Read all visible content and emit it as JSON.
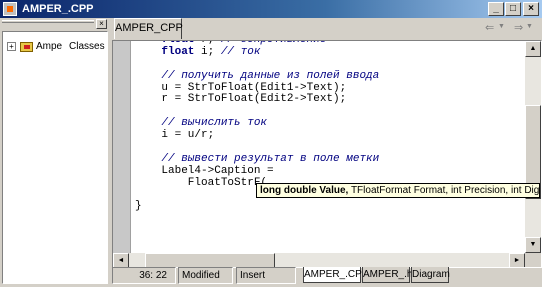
{
  "window": {
    "title": "AMPER_.CPP",
    "buttons": {
      "minimize": "_",
      "maximize": "□",
      "close": "×"
    }
  },
  "left_panel": {
    "close_glyph": "×",
    "tree": {
      "expander": "+",
      "label_1": "Ampe",
      "label_2": "Classes"
    }
  },
  "editor": {
    "tab_label": "AMPER_CPP",
    "nav": {
      "back": "⇐",
      "back_drop": "▼",
      "forward": "⇒",
      "forward_drop": "▼"
    },
    "code_lines": [
      [
        {
          "t": "    "
        },
        {
          "t": "float",
          "c": "kw"
        },
        {
          "t": " r; "
        },
        {
          "t": "// сопротивление",
          "c": "cm"
        }
      ],
      [
        {
          "t": "    "
        },
        {
          "t": "float",
          "c": "kw"
        },
        {
          "t": " i; "
        },
        {
          "t": "// ток",
          "c": "cm"
        }
      ],
      [
        {
          "t": ""
        }
      ],
      [
        {
          "t": "    "
        },
        {
          "t": "// получить данные из полей ввода",
          "c": "cm"
        }
      ],
      [
        {
          "t": "    u = StrToFloat(Edit1->Text);"
        }
      ],
      [
        {
          "t": "    r = StrToFloat(Edit2->Text);"
        }
      ],
      [
        {
          "t": ""
        }
      ],
      [
        {
          "t": "    "
        },
        {
          "t": "// вычислить ток",
          "c": "cm"
        }
      ],
      [
        {
          "t": "    i = u/r;"
        }
      ],
      [
        {
          "t": ""
        }
      ],
      [
        {
          "t": "    "
        },
        {
          "t": "// вывести результат в поле метки",
          "c": "cm"
        }
      ],
      [
        {
          "t": "    Label4->Caption = "
        }
      ],
      [
        {
          "t": "        FloatToStrF("
        }
      ],
      [
        {
          "t": ""
        }
      ],
      [
        {
          "t": "}"
        }
      ]
    ],
    "param_hint": {
      "bold": "long double Value,",
      "rest": " TFloatFormat Format, int Precision, int Digits"
    },
    "scroll": {
      "up": "▲",
      "down": "▼",
      "left": "◄",
      "right": "►"
    }
  },
  "status": {
    "position": "36: 22",
    "modified": "Modified",
    "mode": "Insert",
    "tabs": [
      "AMPER_.CPP",
      "AMPER_.h",
      "Diagram"
    ]
  }
}
